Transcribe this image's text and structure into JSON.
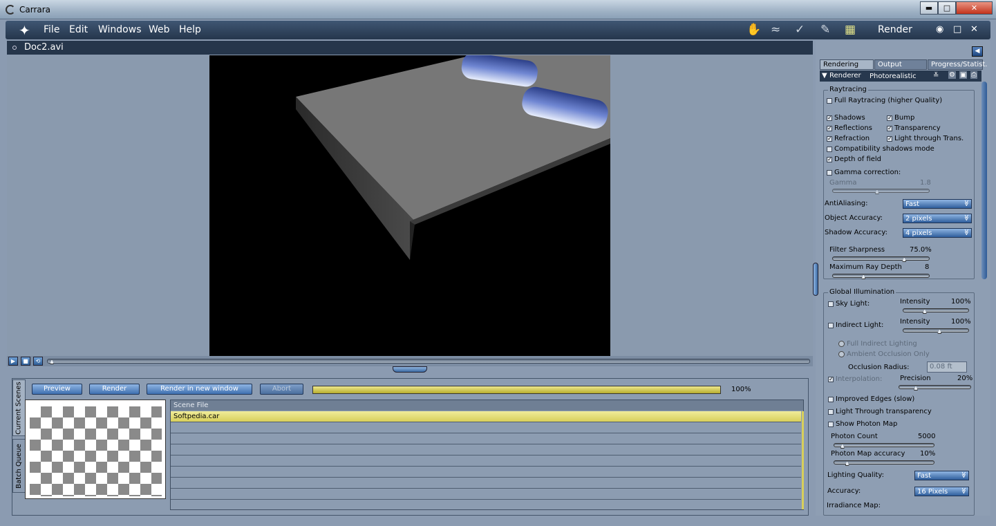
{
  "window": {
    "title": "Carrara",
    "controls": {
      "minimize": "▬",
      "maximize": "□",
      "close": "✕"
    }
  },
  "menubar": {
    "items": [
      "File",
      "Edit",
      "Windows",
      "Web",
      "Help"
    ],
    "room_tools": [
      "hand-icon",
      "wave-icon",
      "pen-check-icon",
      "brush-icon",
      "filmstrip-icon"
    ],
    "room_title": "Render",
    "right_controls": {
      "eye": "◉",
      "square": "□",
      "close": "✕"
    }
  },
  "document": {
    "name": "Doc2.avi"
  },
  "transport": {
    "play": "▶",
    "stop": "■",
    "loop": "⟲"
  },
  "bottom": {
    "tabs": [
      "Current Scenes",
      "Batch Queue"
    ],
    "buttons": {
      "preview": "Preview",
      "render": "Render",
      "render_new": "Render in new window",
      "abort": "Abort"
    },
    "progress": {
      "value": 1.0,
      "label": "100%"
    },
    "table": {
      "header": "Scene File",
      "rows": [
        "Softpedia.car",
        "",
        "",
        "",
        "",
        "",
        "",
        "",
        ""
      ]
    }
  },
  "panel": {
    "tabs": [
      "Rendering",
      "Output",
      "Progress/Statist."
    ],
    "renderer": {
      "label": "Renderer",
      "value": "Photorealistic"
    },
    "raytracing": {
      "title": "Raytracing",
      "full": {
        "label": "Full Raytracing (higher Quality)",
        "checked": false
      },
      "shadows": {
        "label": "Shadows",
        "checked": true
      },
      "bump": {
        "label": "Bump",
        "checked": true
      },
      "reflections": {
        "label": "Reflections",
        "checked": true
      },
      "transparency": {
        "label": "Transparency",
        "checked": true
      },
      "refraction": {
        "label": "Refraction",
        "checked": true
      },
      "light_through": {
        "label": "Light through Trans.",
        "checked": true
      },
      "compat": {
        "label": "Compatibility shadows mode",
        "checked": false
      },
      "dof": {
        "label": "Depth of field",
        "checked": true
      },
      "gamma_corr": {
        "label": "Gamma correction:",
        "checked": false
      },
      "gamma": {
        "label": "Gamma",
        "value": "1.8",
        "fraction": 0.45
      }
    },
    "aa": {
      "label": "AntiAliasing:",
      "value": "Fast"
    },
    "obj_acc": {
      "label": "Object Accuracy:",
      "value": "2 pixels"
    },
    "shadow_acc": {
      "label": "Shadow Accuracy:",
      "value": "4 pixels"
    },
    "filter": {
      "label": "Filter Sharpness",
      "value": "75.0%",
      "fraction": 0.75
    },
    "ray_depth": {
      "label": "Maximum Ray Depth",
      "value": "8",
      "fraction": 0.3
    },
    "gi": {
      "title": "Global Illumination",
      "sky": {
        "label": "Sky Light:",
        "checked": false,
        "intensity_label": "Intensity",
        "value": "100%",
        "fraction": 0.3
      },
      "indirect": {
        "label": "Indirect Light:",
        "checked": false,
        "intensity_label": "Intensity",
        "value": "100%",
        "fraction": 0.55
      },
      "full_indirect": "Full Indirect Lighting",
      "ambient": "Ambient Occlusion Only",
      "occlusion": {
        "label": "Occlusion Radius:",
        "value": "0.08 ft"
      },
      "interp": {
        "label": "Interpolation:",
        "checked": true,
        "precision_label": "Precision",
        "value": "20%",
        "fraction": 0.2
      },
      "edges": {
        "label": "Improved Edges (slow)",
        "checked": false
      },
      "lt": {
        "label": "Light Through transparency",
        "checked": false
      },
      "photon_map": {
        "label": "Show Photon Map",
        "checked": false
      },
      "photon_count": {
        "label": "Photon Count",
        "value": "5000",
        "fraction": 0.05
      },
      "photon_acc": {
        "label": "Photon Map accuracy",
        "value": "10%",
        "fraction": 0.1
      },
      "lighting_quality": {
        "label": "Lighting Quality:",
        "value": "Fast"
      },
      "accuracy": {
        "label": "Accuracy:",
        "value": "16 Pixels"
      },
      "irradiance": {
        "label": "Irradiance Map:"
      }
    }
  },
  "colors": {
    "accent": "#3f70b0",
    "progress": "#d8cf5b",
    "dark": "#26364b"
  }
}
